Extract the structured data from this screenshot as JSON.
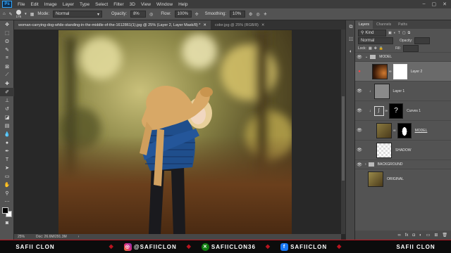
{
  "menubar": {
    "logo": "Ps",
    "items": [
      "File",
      "Edit",
      "Image",
      "Layer",
      "Type",
      "Select",
      "Filter",
      "3D",
      "View",
      "Window",
      "Help"
    ],
    "window_controls": [
      "–",
      "▢",
      "✕"
    ]
  },
  "options": {
    "brush_size": "175",
    "mode_label": "Mode:",
    "mode_value": "Normal",
    "opacity_label": "Opacity:",
    "opacity_value": "8%",
    "flow_label": "Flow:",
    "flow_value": "100%",
    "smoothing_label": "Smoothing:",
    "smoothing_value": "10%"
  },
  "tabs": [
    {
      "label": "woman-carrying-dog-while-standing-in-the-middle-of-the-1612861(1).jpg @ 25% (Layer 2, Layer Mask/8) *",
      "active": true
    },
    {
      "label": "color.jpg @ 25% (RGB/8)",
      "active": false
    }
  ],
  "status": {
    "zoom": "25%",
    "doc": "Doc: 26.6M/291.3M"
  },
  "layers_panel": {
    "tabs": [
      "Layers",
      "Channels",
      "Paths"
    ],
    "kind_label": "Kind",
    "blend_mode": "Normal",
    "opacity_label": "Opacity:",
    "fill_label": "Fill:",
    "lock_label": "Lock:",
    "layers": [
      {
        "name": "MODEL",
        "type": "group"
      },
      {
        "name": "Layer 2",
        "type": "masked",
        "active": true
      },
      {
        "name": "Layer 1",
        "type": "layer"
      },
      {
        "name": "Curves 1",
        "type": "adjustment"
      },
      {
        "name": "MODEL",
        "type": "masked-photo"
      },
      {
        "name": "SHADOW",
        "type": "transparent"
      },
      {
        "name": "BACKGROUND",
        "type": "group"
      },
      {
        "name": "ORIGINAL",
        "type": "photo"
      }
    ]
  },
  "banner": {
    "left": "SAFII CLON",
    "right": "SAFII CLON",
    "instagram": "@SAFIICLON",
    "xbox": "SAFIICLON36",
    "facebook": "SAFIICLON",
    "colors": {
      "accent": "#b8141f"
    }
  }
}
